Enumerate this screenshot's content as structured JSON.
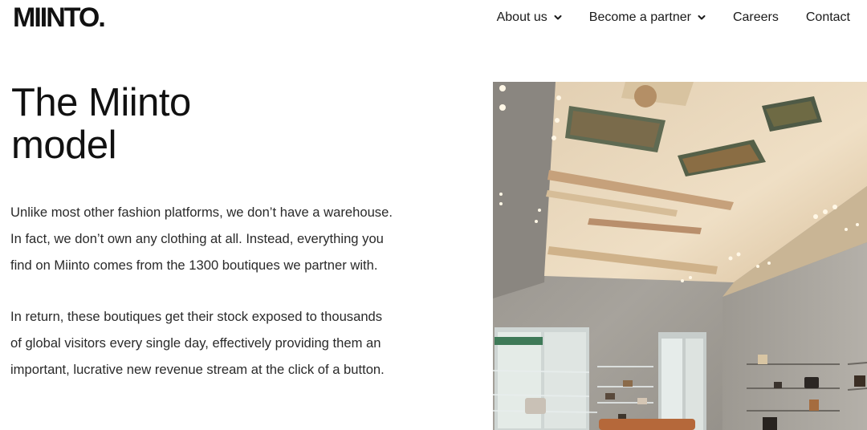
{
  "header": {
    "logo": "MIINTO.",
    "nav": [
      {
        "label": "About us",
        "has_dropdown": true,
        "icon": "chevron-down-icon"
      },
      {
        "label": "Become a partner",
        "has_dropdown": true,
        "icon": "chevron-down-icon"
      },
      {
        "label": "Careers",
        "has_dropdown": false
      },
      {
        "label": "Contact",
        "has_dropdown": false
      }
    ]
  },
  "main": {
    "title_lines": [
      "The Miinto",
      "model"
    ],
    "paragraph_1": [
      "Unlike most other fashion platforms, we don’t have a warehouse.",
      "In fact, we don’t own any clothing at all. Instead, everything you",
      "find on Miinto comes from the 1300 boutiques we partner with."
    ],
    "paragraph_2": [
      "In return, these boutiques get their stock exposed to thousands",
      "of global visitors every single day, effectively providing them an",
      "important, lucrative new revenue stream at the click of a button."
    ]
  },
  "colors": {
    "text": "#1a1a1a",
    "background": "#ffffff",
    "wall": "#9a958e",
    "ceiling": "#e9d8bd"
  }
}
